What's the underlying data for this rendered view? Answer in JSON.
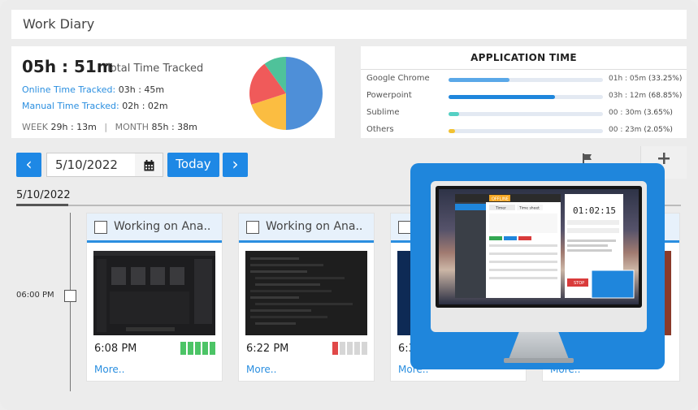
{
  "header": {
    "title": "Work Diary"
  },
  "stats": {
    "total_value": "05h : 51m",
    "total_label": "Total Time Tracked",
    "online_label": "Online Time Tracked:",
    "online_value": "03h : 45m",
    "manual_label": "Manual Time Tracked:",
    "manual_value": "02h : 02m",
    "week_label": "WEEK",
    "week_value": "29h : 13m",
    "separator": "|",
    "month_label": "MONTH",
    "month_value": "85h : 38m",
    "pie_colors": [
      "#4e8fd8",
      "#fbbd41",
      "#f05a5a",
      "#4fc29a"
    ],
    "pie_fractions": [
      0.5,
      0.2,
      0.2,
      0.1
    ]
  },
  "app_time": {
    "title": "APPLICATION TIME",
    "apps": [
      {
        "name": "Google Chrome",
        "time": "01h : 05m",
        "pct": "(33.25%)",
        "fraction": 0.3925,
        "color": "#5aa8e8"
      },
      {
        "name": "Powerpoint",
        "time": "03h : 12m",
        "pct": "(68.85%)",
        "fraction": 0.6885,
        "color": "#1f86dc"
      },
      {
        "name": "Sublime",
        "time": "00 : 30m",
        "pct": "(3.65%)",
        "fraction": 0.0665,
        "color": "#55d0c4"
      },
      {
        "name": "Others",
        "time": "00 : 23m",
        "pct": "(2.05%)",
        "fraction": 0.0405,
        "color": "#f2c232"
      }
    ]
  },
  "toolbar": {
    "prev_icon": "chevron-left-icon",
    "prev_glyph": "‹",
    "date_value": "5/10/2022",
    "calendar_icon": "calendar-icon",
    "today_label": "Today",
    "next_icon": "chevron-right-icon",
    "next_glyph": "›"
  },
  "day": {
    "date_label": "5/10/2022",
    "time_slot": "06:00 PM"
  },
  "screenshots": [
    {
      "title": "Working on Ana..",
      "time": "6:08 PM",
      "more": "More..",
      "activity": [
        "#4cc466",
        "#4cc466",
        "#4cc466",
        "#4cc466",
        "#4cc466"
      ]
    },
    {
      "title": "Working on Ana..",
      "time": "6:22 PM",
      "more": "More..",
      "activity": [
        "#e04848",
        "#d6d6d6",
        "#d6d6d6",
        "#d6d6d6",
        "#d6d6d6"
      ]
    },
    {
      "title": "",
      "time": "6:3",
      "more": "More..",
      "activity": []
    },
    {
      "title": "",
      "time": "",
      "more": "More..",
      "activity": []
    }
  ],
  "promo": {
    "app_tabs": [
      "Timer",
      "Time sheet"
    ],
    "status": "OFFLINE",
    "timer": "01:02:15",
    "stop_label": "STOP",
    "colors": {
      "accent": "#1f86dc",
      "offline": "#f5a623",
      "stop": "#d93b3b"
    }
  }
}
